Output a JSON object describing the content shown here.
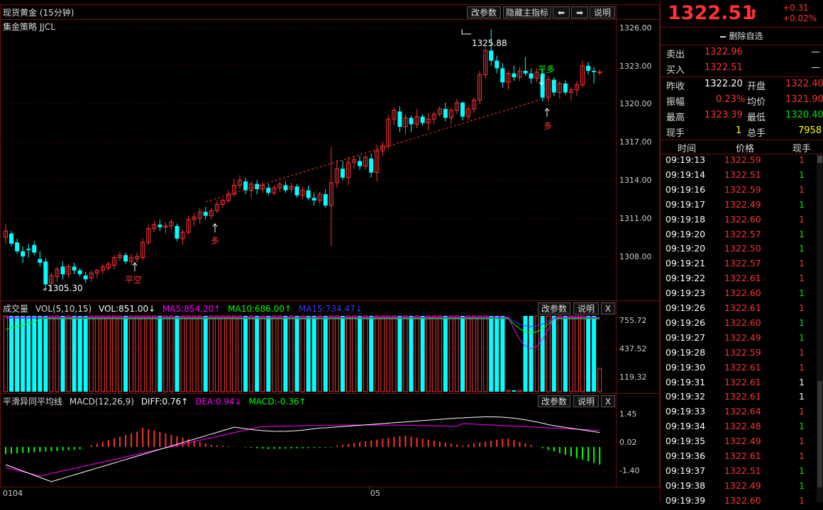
{
  "main_panel": {
    "title": "现货黄金 (15分钟)",
    "strategy": "集金策略 JJCL",
    "buttons": [
      "改参数",
      "隐藏主指标",
      "⬅",
      "➡",
      "说明"
    ],
    "price_axis": [
      "1326.00",
      "1323.00",
      "1320.00",
      "1317.00",
      "1314.00",
      "1311.00",
      "1308.00"
    ],
    "annotations": {
      "high_label": "1325.88",
      "low_label": "1305.30",
      "signals": [
        "平空",
        "多",
        "平多",
        "多"
      ]
    }
  },
  "volume_panel": {
    "title": "成交量",
    "indicator": "VOL(5,10,15)",
    "vol": "VOL:851.00↓",
    "ma5": "MA5:854.20↑",
    "ma10": "MA10:686.00↑",
    "ma15": "MA15:734.47↓",
    "buttons": [
      "改参数",
      "说明",
      "X"
    ],
    "axis": [
      "755.72",
      "437.52",
      "119.32"
    ]
  },
  "macd_panel": {
    "title": "平滑异同平均线",
    "indicator": "MACD(12,26,9)",
    "diff": "DIFF:0.76↑",
    "dea": "DEA:0.94↓",
    "macd": "MACD:-0.36↑",
    "buttons": [
      "改参数",
      "说明",
      "X"
    ],
    "axis": [
      "1.45",
      "0.02",
      "-1.40"
    ]
  },
  "time_axis": [
    "0104",
    "05"
  ],
  "quote": {
    "price": "1322.51",
    "arrow": "⬆",
    "change": "+0.31",
    "change_pct": "+0.02%",
    "remove_fav": "删除自选",
    "sell_label": "卖出",
    "sell_price": "1322.96",
    "sell_vol": "—",
    "buy_label": "买入",
    "buy_price": "1322.51",
    "buy_vol": "—",
    "prev_close_label": "昨收",
    "prev_close": "1322.20",
    "open_label": "开盘",
    "open": "1322.40",
    "amp_label": "振幅",
    "amp": "0.23%",
    "avg_label": "均价",
    "avg": "1321.90",
    "high_label": "最高",
    "high": "1323.39",
    "low_label": "最低",
    "low": "1320.40",
    "cur_vol_label": "现手",
    "cur_vol": "1",
    "total_vol_label": "总手",
    "total_vol": "7958"
  },
  "ticks_header": {
    "time": "时间",
    "price": "价格",
    "vol": "现手"
  },
  "ticks": [
    {
      "time": "09:19:13",
      "price": "1322.59",
      "vol": "1",
      "c": "red"
    },
    {
      "time": "09:19:14",
      "price": "1322.51",
      "vol": "1",
      "c": "green"
    },
    {
      "time": "09:19:16",
      "price": "1322.59",
      "vol": "1",
      "c": "red"
    },
    {
      "time": "09:19:17",
      "price": "1322.49",
      "vol": "1",
      "c": "green"
    },
    {
      "time": "09:19:18",
      "price": "1322.60",
      "vol": "1",
      "c": "red"
    },
    {
      "time": "09:19:20",
      "price": "1322.57",
      "vol": "1",
      "c": "green"
    },
    {
      "time": "09:19:20",
      "price": "1322.50",
      "vol": "1",
      "c": "green"
    },
    {
      "time": "09:19:21",
      "price": "1322.57",
      "vol": "1",
      "c": "red"
    },
    {
      "time": "09:19:22",
      "price": "1322.61",
      "vol": "1",
      "c": "red"
    },
    {
      "time": "09:19:23",
      "price": "1322.60",
      "vol": "1",
      "c": "green"
    },
    {
      "time": "09:19:26",
      "price": "1322.61",
      "vol": "1",
      "c": "red"
    },
    {
      "time": "09:19:26",
      "price": "1322.60",
      "vol": "1",
      "c": "green"
    },
    {
      "time": "09:19:27",
      "price": "1322.49",
      "vol": "1",
      "c": "green"
    },
    {
      "time": "09:19:28",
      "price": "1322.59",
      "vol": "1",
      "c": "red"
    },
    {
      "time": "09:19:30",
      "price": "1322.61",
      "vol": "1",
      "c": "red"
    },
    {
      "time": "09:19:31",
      "price": "1322.61",
      "vol": "1",
      "c": "white"
    },
    {
      "time": "09:19:32",
      "price": "1322.61",
      "vol": "1",
      "c": "white"
    },
    {
      "time": "09:19:33",
      "price": "1322.64",
      "vol": "1",
      "c": "red"
    },
    {
      "time": "09:19:34",
      "price": "1322.48",
      "vol": "1",
      "c": "green"
    },
    {
      "time": "09:19:35",
      "price": "1322.49",
      "vol": "1",
      "c": "red"
    },
    {
      "time": "09:19:36",
      "price": "1322.61",
      "vol": "1",
      "c": "red"
    },
    {
      "time": "09:19:37",
      "price": "1322.51",
      "vol": "1",
      "c": "green"
    },
    {
      "time": "09:19:38",
      "price": "1322.49",
      "vol": "1",
      "c": "green"
    },
    {
      "time": "09:19:39",
      "price": "1322.60",
      "vol": "1",
      "c": "red"
    }
  ],
  "colors": {
    "up": "#ff3232",
    "down": "#00ffff",
    "ma5": "#ff00ff",
    "ma10": "#00ff00",
    "ma15": "#3b3bff",
    "grid": "#6a1010"
  },
  "chart_data": {
    "type": "candlestick",
    "x_start_label": "0104",
    "x_mid_label": "05",
    "candles": [
      [
        1309.5,
        1310.6,
        1309.0,
        1310.0
      ],
      [
        1309.8,
        1310.0,
        1308.8,
        1309.0
      ],
      [
        1309.1,
        1309.4,
        1308.2,
        1308.4
      ],
      [
        1308.4,
        1308.8,
        1307.5,
        1308.0
      ],
      [
        1308.6,
        1309.0,
        1307.9,
        1308.5
      ],
      [
        1308.9,
        1309.2,
        1308.1,
        1308.3
      ],
      [
        1307.8,
        1308.4,
        1307.2,
        1307.5
      ],
      [
        1307.6,
        1307.9,
        1305.3,
        1305.8
      ],
      [
        1305.9,
        1306.7,
        1305.3,
        1306.5
      ],
      [
        1306.4,
        1307.2,
        1306.0,
        1307.0
      ],
      [
        1307.2,
        1307.6,
        1306.2,
        1306.6
      ],
      [
        1306.6,
        1307.4,
        1306.3,
        1307.2
      ],
      [
        1307.2,
        1307.5,
        1306.6,
        1306.9
      ],
      [
        1306.9,
        1307.1,
        1306.4,
        1306.6
      ],
      [
        1306.5,
        1306.8,
        1305.9,
        1306.2
      ],
      [
        1306.3,
        1306.9,
        1306.0,
        1306.7
      ],
      [
        1306.7,
        1307.0,
        1306.3,
        1306.9
      ],
      [
        1306.9,
        1307.4,
        1306.6,
        1307.2
      ],
      [
        1307.1,
        1307.6,
        1306.9,
        1307.4
      ],
      [
        1307.3,
        1308.1,
        1307.0,
        1307.9
      ],
      [
        1307.9,
        1308.4,
        1307.6,
        1308.1
      ],
      [
        1308.1,
        1308.3,
        1307.4,
        1307.6
      ],
      [
        1307.6,
        1308.2,
        1307.3,
        1307.9
      ],
      [
        1307.8,
        1308.3,
        1307.5,
        1308.0
      ],
      [
        1307.9,
        1309.4,
        1307.7,
        1309.1
      ],
      [
        1309.1,
        1310.5,
        1308.9,
        1310.2
      ],
      [
        1310.2,
        1310.8,
        1309.9,
        1310.5
      ],
      [
        1310.5,
        1310.9,
        1310.0,
        1310.3
      ],
      [
        1310.3,
        1310.7,
        1309.8,
        1310.4
      ],
      [
        1310.4,
        1310.9,
        1310.1,
        1310.7
      ],
      [
        1310.4,
        1310.6,
        1309.2,
        1309.4
      ],
      [
        1309.4,
        1310.1,
        1308.9,
        1309.9
      ],
      [
        1309.9,
        1311.2,
        1309.7,
        1310.9
      ],
      [
        1310.9,
        1311.4,
        1310.4,
        1311.1
      ],
      [
        1311.0,
        1311.8,
        1310.6,
        1311.5
      ],
      [
        1311.5,
        1311.9,
        1310.9,
        1311.2
      ],
      [
        1311.2,
        1311.8,
        1310.9,
        1311.6
      ],
      [
        1311.6,
        1312.4,
        1311.4,
        1312.1
      ],
      [
        1312.1,
        1312.6,
        1311.8,
        1312.4
      ],
      [
        1312.4,
        1313.2,
        1312.2,
        1312.9
      ],
      [
        1312.9,
        1314.1,
        1312.7,
        1313.6
      ],
      [
        1313.6,
        1314.4,
        1313.3,
        1314.0
      ],
      [
        1313.9,
        1314.2,
        1312.9,
        1313.2
      ],
      [
        1313.2,
        1313.9,
        1312.6,
        1313.7
      ],
      [
        1313.7,
        1314.0,
        1312.9,
        1313.3
      ],
      [
        1313.3,
        1313.8,
        1313.0,
        1313.6
      ],
      [
        1313.4,
        1313.7,
        1312.8,
        1313.0
      ],
      [
        1313.0,
        1313.6,
        1312.8,
        1313.4
      ],
      [
        1313.4,
        1313.9,
        1313.1,
        1313.7
      ],
      [
        1313.6,
        1313.9,
        1313.0,
        1313.2
      ],
      [
        1313.3,
        1313.8,
        1313.0,
        1313.5
      ],
      [
        1313.5,
        1313.7,
        1312.6,
        1312.8
      ],
      [
        1312.8,
        1313.5,
        1312.5,
        1313.2
      ],
      [
        1313.2,
        1313.6,
        1312.4,
        1312.6
      ],
      [
        1312.6,
        1313.0,
        1312.0,
        1312.4
      ],
      [
        1312.4,
        1313.1,
        1312.1,
        1312.9
      ],
      [
        1312.9,
        1313.3,
        1311.8,
        1312.0
      ],
      [
        1312.0,
        1316.6,
        1308.8,
        1313.8
      ],
      [
        1313.8,
        1315.6,
        1313.4,
        1314.9
      ],
      [
        1314.9,
        1315.5,
        1314.0,
        1314.2
      ],
      [
        1314.2,
        1315.8,
        1313.6,
        1315.4
      ],
      [
        1315.4,
        1315.9,
        1314.9,
        1315.6
      ],
      [
        1315.5,
        1315.9,
        1314.8,
        1315.1
      ],
      [
        1315.1,
        1316.0,
        1314.8,
        1315.8
      ],
      [
        1315.7,
        1316.1,
        1314.2,
        1314.6
      ],
      [
        1314.6,
        1316.8,
        1313.9,
        1316.3
      ],
      [
        1316.3,
        1317.0,
        1315.9,
        1316.7
      ],
      [
        1316.7,
        1319.1,
        1316.4,
        1318.8
      ],
      [
        1318.8,
        1319.7,
        1318.3,
        1319.5
      ],
      [
        1319.4,
        1319.8,
        1317.8,
        1318.2
      ],
      [
        1318.2,
        1319.2,
        1317.6,
        1318.9
      ],
      [
        1318.9,
        1319.1,
        1317.8,
        1318.4
      ],
      [
        1318.4,
        1319.6,
        1318.1,
        1319.0
      ],
      [
        1319.0,
        1319.2,
        1318.3,
        1318.5
      ],
      [
        1318.5,
        1319.3,
        1317.9,
        1318.8
      ],
      [
        1318.8,
        1319.4,
        1318.4,
        1319.2
      ],
      [
        1319.2,
        1319.8,
        1319.0,
        1319.6
      ],
      [
        1319.6,
        1320.1,
        1318.6,
        1318.9
      ],
      [
        1318.9,
        1319.7,
        1318.4,
        1319.5
      ],
      [
        1319.5,
        1320.4,
        1319.2,
        1320.1
      ],
      [
        1320.1,
        1320.2,
        1318.7,
        1319.0
      ],
      [
        1319.0,
        1319.9,
        1318.7,
        1319.6
      ],
      [
        1319.6,
        1320.5,
        1319.3,
        1320.3
      ],
      [
        1320.3,
        1322.6,
        1320.0,
        1322.3
      ],
      [
        1322.3,
        1324.5,
        1322.0,
        1324.2
      ],
      [
        1324.2,
        1325.88,
        1323.0,
        1323.4
      ],
      [
        1323.4,
        1323.8,
        1322.4,
        1322.8
      ],
      [
        1322.8,
        1323.2,
        1321.3,
        1321.7
      ],
      [
        1321.7,
        1322.6,
        1321.1,
        1322.4
      ],
      [
        1322.4,
        1323.0,
        1321.8,
        1322.1
      ],
      [
        1322.1,
        1322.9,
        1321.8,
        1322.6
      ],
      [
        1322.6,
        1323.7,
        1322.2,
        1322.4
      ],
      [
        1322.4,
        1322.8,
        1321.6,
        1322.0
      ],
      [
        1322.0,
        1322.8,
        1321.7,
        1322.5
      ],
      [
        1322.4,
        1322.7,
        1320.2,
        1320.5
      ],
      [
        1320.5,
        1322.2,
        1320.2,
        1321.9
      ],
      [
        1321.9,
        1322.1,
        1320.6,
        1320.9
      ],
      [
        1320.9,
        1321.8,
        1320.4,
        1321.6
      ],
      [
        1321.6,
        1321.9,
        1320.7,
        1320.9
      ],
      [
        1320.9,
        1321.3,
        1320.3,
        1321.1
      ],
      [
        1321.1,
        1321.8,
        1320.6,
        1321.5
      ],
      [
        1321.5,
        1323.4,
        1321.3,
        1323.0
      ],
      [
        1323.0,
        1323.3,
        1322.3,
        1322.6
      ],
      [
        1322.6,
        1322.9,
        1321.6,
        1322.5
      ],
      [
        1322.5,
        1322.7,
        1322.2,
        1322.51
      ]
    ],
    "price_ylim": [
      1305.0,
      1327.0
    ]
  }
}
